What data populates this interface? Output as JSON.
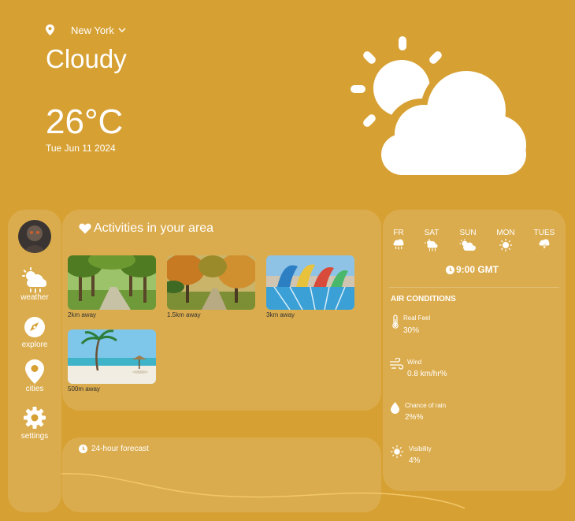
{
  "header": {
    "location": "New York",
    "condition": "Cloudy",
    "temperature": "26°C",
    "date": "Tue Jun 11 2024"
  },
  "sidebar": {
    "items": [
      {
        "label": "weather",
        "icon": "cloud-rain-sun-icon"
      },
      {
        "label": "explore",
        "icon": "compass-icon"
      },
      {
        "label": "cities",
        "icon": "map-pin-icon"
      },
      {
        "label": "settings",
        "icon": "gear-icon"
      }
    ]
  },
  "activities": {
    "title": "Activities in your area",
    "items": [
      {
        "distance": "2km away",
        "scene": "park-alley"
      },
      {
        "distance": "1.5km away",
        "scene": "autumn-park"
      },
      {
        "distance": "3km away",
        "scene": "water-park"
      },
      {
        "distance": "500m away",
        "scene": "beach"
      }
    ]
  },
  "forecast24": {
    "title": "24-hour forecast"
  },
  "week": {
    "days": [
      {
        "label": "FR",
        "icon": "rain-cloud-icon"
      },
      {
        "label": "SAT",
        "icon": "sun-rain-icon"
      },
      {
        "label": "SUN",
        "icon": "sun-cloud-icon"
      },
      {
        "label": "MON",
        "icon": "sun-icon"
      },
      {
        "label": "TUES",
        "icon": "thunder-cloud-icon"
      }
    ],
    "time": "9:00 GMT"
  },
  "air": {
    "title": "AIR CONDITIONS",
    "items": [
      {
        "label": "Real Feel",
        "value": "30%",
        "icon": "thermometer-icon"
      },
      {
        "label": "Wind",
        "value": "0.8 km/hr%",
        "icon": "wind-icon"
      },
      {
        "label": "Chance of rain",
        "value": "2%%",
        "icon": "raindrop-icon"
      },
      {
        "label": "Visibility",
        "value": "4%",
        "icon": "sun-icon"
      }
    ]
  },
  "colors": {
    "background": "#d6a033",
    "panel": "rgba(255,255,255,0.13)",
    "text": "#ffffff",
    "forecast_line": "#f2c76a"
  }
}
